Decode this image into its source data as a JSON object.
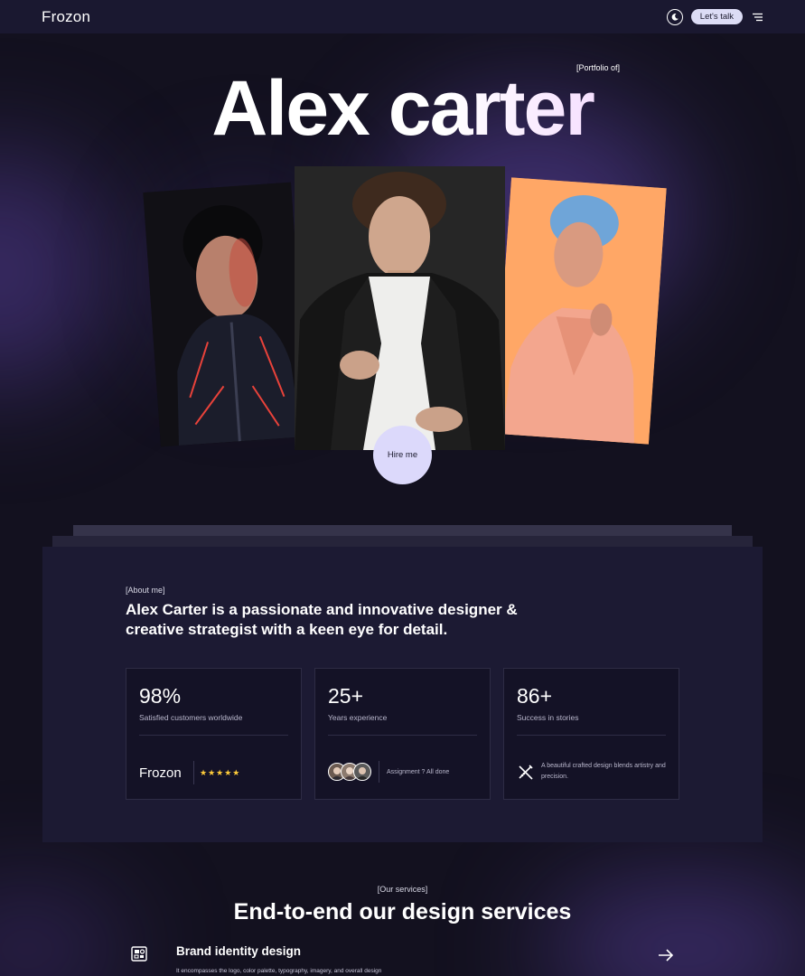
{
  "nav": {
    "logo": "Frozon",
    "cta_label": "Let's talk",
    "icons": [
      "moon-icon",
      "menu-icon"
    ]
  },
  "hero": {
    "tag": "[Portfolio of]",
    "name": "Alex carter",
    "hire_label": "Hire me"
  },
  "about": {
    "label": "[About me]",
    "text": "Alex Carter is a passionate and innovative designer & creative strategist with a keen eye for detail.",
    "stats": [
      {
        "value": "98%",
        "label": "Satisfied customers worldwide",
        "brand": "Frozon",
        "stars": "★★★★★"
      },
      {
        "value": "25+",
        "label": "Years experience",
        "footer": "Assignment ? All done"
      },
      {
        "value": "86+",
        "label": "Success in stories",
        "footer": "A beautiful crafted design blends artistry and precision."
      }
    ]
  },
  "services": {
    "label": "[Our services]",
    "title": "End-to-end our design services",
    "items": [
      {
        "name": "Brand identity design",
        "description": "It encompasses the logo, color palette, typography, imagery, and overall design"
      }
    ]
  },
  "colors": {
    "background": "#13111f",
    "card": "#1c1a33",
    "accent": "#dcd9fb",
    "star": "#ffcc3a"
  }
}
